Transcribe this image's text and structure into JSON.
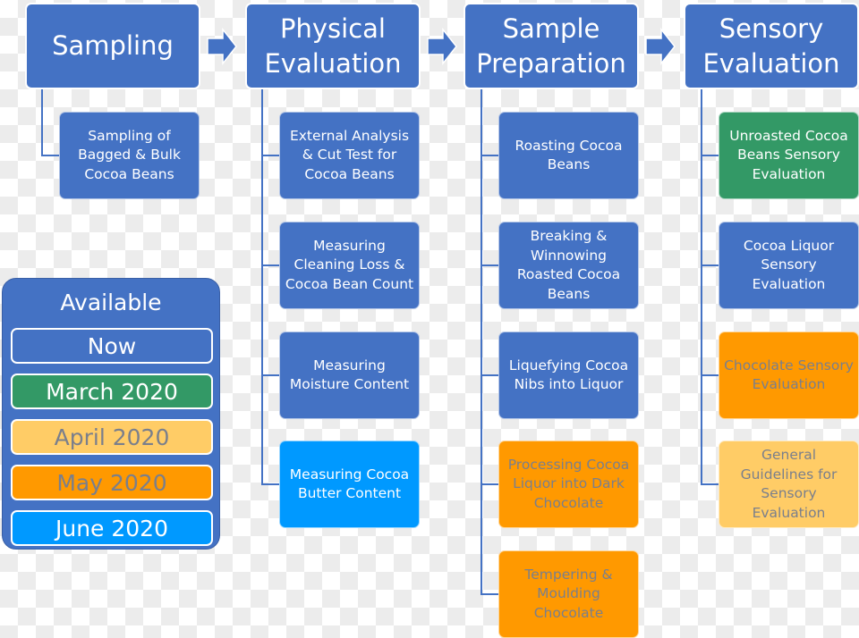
{
  "colors": {
    "Now": "#4472C4",
    "March 2020": "#339966",
    "April 2020": "#FFCC66",
    "May 2020": "#FF9900",
    "June 2020": "#0099FF",
    "dark_text": "#7a7f8c",
    "light_text": "#ffffff"
  },
  "columns": [
    {
      "title": "Sampling",
      "children": [
        {
          "label": "Sampling of Bagged & Bulk Cocoa Beans",
          "status": "Now"
        }
      ]
    },
    {
      "title": "Physical Evaluation",
      "children": [
        {
          "label": "External Analysis & Cut Test for Cocoa Beans",
          "status": "Now"
        },
        {
          "label": "Measuring Cleaning Loss & Cocoa Bean Count",
          "status": "Now"
        },
        {
          "label": "Measuring Moisture Content",
          "status": "Now"
        },
        {
          "label": "Measuring Cocoa Butter Content",
          "status": "June 2020"
        }
      ]
    },
    {
      "title": "Sample Preparation",
      "children": [
        {
          "label": "Roasting Cocoa Beans",
          "status": "Now"
        },
        {
          "label": "Breaking & Winnowing Roasted Cocoa Beans",
          "status": "Now"
        },
        {
          "label": "Liquefying Cocoa Nibs into Liquor",
          "status": "Now"
        },
        {
          "label": "Processing Cocoa Liquor into Dark Chocolate",
          "status": "May 2020"
        },
        {
          "label": "Tempering & Moulding Chocolate",
          "status": "May 2020"
        }
      ]
    },
    {
      "title": "Sensory Evaluation",
      "children": [
        {
          "label": "Unroasted Cocoa Beans Sensory Evaluation",
          "status": "March 2020"
        },
        {
          "label": "Cocoa Liquor Sensory Evaluation",
          "status": "Now"
        },
        {
          "label": "Chocolate Sensory Evaluation",
          "status": "May 2020"
        },
        {
          "label": "General Guidelines for Sensory Evaluation",
          "status": "April 2020"
        }
      ]
    }
  ],
  "legend": {
    "title": "Available",
    "items": [
      "Now",
      "March 2020",
      "April 2020",
      "May 2020",
      "June 2020"
    ]
  }
}
